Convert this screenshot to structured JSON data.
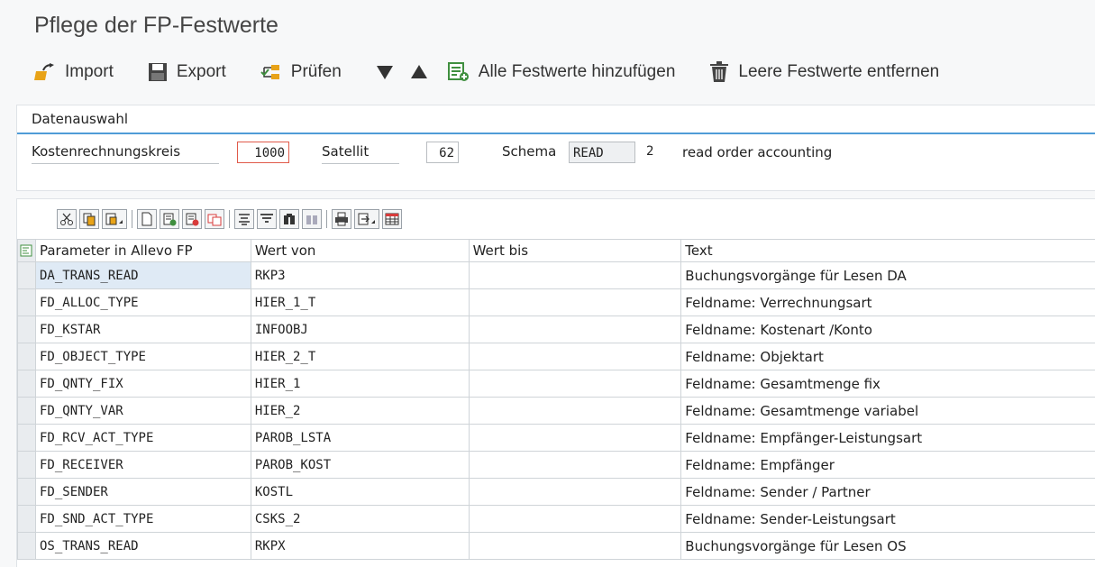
{
  "title": "Pflege der FP-Festwerte",
  "toolbar": {
    "import": "Import",
    "export": "Export",
    "check": "Prüfen",
    "add_all": "Alle Festwerte hinzufügen",
    "remove_empty": "Leere Festwerte entfernen"
  },
  "selection": {
    "title": "Datenauswahl",
    "controlling_area_label": "Kostenrechnungskreis",
    "controlling_area_value": "1000",
    "satellite_label": "Satellit",
    "satellite_value": "62",
    "schema_label": "Schema",
    "schema_value": "READ",
    "schema_number": "2",
    "schema_description": "read order accounting"
  },
  "grid": {
    "columns": [
      "Parameter in Allevo FP",
      "Wert von",
      "Wert bis",
      "Text"
    ],
    "rows": [
      {
        "param": "DA_TRANS_READ",
        "from": "RKP3",
        "to": "",
        "text": "Buchungsvorgänge für Lesen DA"
      },
      {
        "param": "FD_ALLOC_TYPE",
        "from": "HIER_1_T",
        "to": "",
        "text": "Feldname: Verrechnungsart"
      },
      {
        "param": "FD_KSTAR",
        "from": "INFOOBJ",
        "to": "",
        "text": "Feldname: Kostenart /Konto"
      },
      {
        "param": "FD_OBJECT_TYPE",
        "from": "HIER_2_T",
        "to": "",
        "text": "Feldname: Objektart"
      },
      {
        "param": "FD_QNTY_FIX",
        "from": "HIER_1",
        "to": "",
        "text": "Feldname: Gesamtmenge fix"
      },
      {
        "param": "FD_QNTY_VAR",
        "from": "HIER_2",
        "to": "",
        "text": "Feldname: Gesamtmenge variabel"
      },
      {
        "param": "FD_RCV_ACT_TYPE",
        "from": "PAROB_LSTA",
        "to": "",
        "text": "Feldname: Empfänger-Leistungsart"
      },
      {
        "param": "FD_RECEIVER",
        "from": "PAROB_KOST",
        "to": "",
        "text": "Feldname: Empfänger"
      },
      {
        "param": "FD_SENDER",
        "from": "KOSTL",
        "to": "",
        "text": "Feldname: Sender / Partner"
      },
      {
        "param": "FD_SND_ACT_TYPE",
        "from": "CSKS_2",
        "to": "",
        "text": "Feldname: Sender-Leistungsart"
      },
      {
        "param": "OS_TRANS_READ",
        "from": "RKPX",
        "to": "",
        "text": "Buchungsvorgänge für Lesen OS"
      }
    ]
  },
  "colors": {
    "accent": "#4f9cd7",
    "required_border": "#e05a4a",
    "icon_gold": "#e8a318",
    "icon_green": "#3f8f3f"
  }
}
